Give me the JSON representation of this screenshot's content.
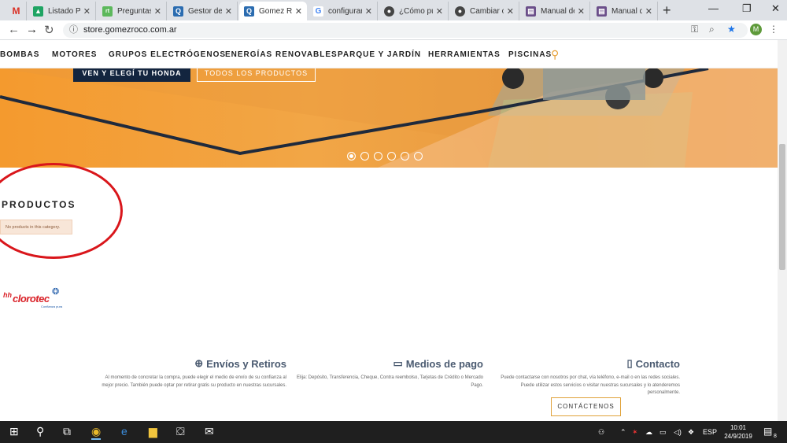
{
  "tabs": [
    {
      "label": "",
      "icon": "gmail-icon",
      "color": "#d93025"
    },
    {
      "label": "Listado Pr",
      "icon": "drive-icon",
      "color": "#1fa463"
    },
    {
      "label": "Preguntas",
      "icon": "rt-icon",
      "color": "#5cb85c"
    },
    {
      "label": "Gestor de",
      "icon": "prestashop-icon",
      "color": "#2b6cb0"
    },
    {
      "label": "Gomez Ro",
      "icon": "prestashop-icon",
      "color": "#2b6cb0"
    },
    {
      "label": "configurar",
      "icon": "google-icon",
      "color": "#4285f4"
    },
    {
      "label": "¿Cómo pu",
      "icon": "forum-icon",
      "color": "#444444"
    },
    {
      "label": "Cambiar o",
      "icon": "forum-icon",
      "color": "#444444"
    },
    {
      "label": "Manual de",
      "icon": "doc-icon",
      "color": "#6b4f8a"
    },
    {
      "label": "Manual de",
      "icon": "doc-icon",
      "color": "#6b4f8a"
    }
  ],
  "address": {
    "url": "store.gomezroco.com.ar"
  },
  "profile": {
    "initial": "M"
  },
  "site_nav": [
    "BOMBAS",
    "MOTORES",
    "GRUPOS ELECTRÓGENOS",
    "ENERGÍAS RENOVABLES",
    "PARQUE Y JARDÍN",
    "HERRAMIENTAS",
    "PISCINAS"
  ],
  "banner": {
    "btn_primary": "VEN Y ELEGÍ TU HONDA",
    "btn_secondary": "TODOS LOS PRODUCTOS",
    "slide_count": 6,
    "active_slide": 1
  },
  "products": {
    "title": "PRODUCTOS",
    "notice": "No products in this category."
  },
  "brand_logo": {
    "hh": "hh",
    "name": "clorotec",
    "tagline": "Confianza pura"
  },
  "footer": {
    "shipping": {
      "title": "Envíos y Retiros",
      "text": "Al momento de concretar la compra, puede elegir el medio de envío de su confianza al mejor precio. También puede optar por retirar gratis su producto en nuestras sucursales."
    },
    "payment": {
      "title": "Medios de pago",
      "text": "Elija: Depósito, Transferencia, Cheque, Contra reembolso, Tarjetas de Crédito o Mercado Pago."
    },
    "contact": {
      "title": "Contacto",
      "text": "Puede contactarse con nosotros por chat, vía teléfono, e-mail o en las redes sociales. Puede utilizar estos servicios o visitar nuestras sucursales y lo atenderemos personalmente.",
      "button": "CONTÁCTENOS"
    }
  },
  "taskbar": {
    "lang": "ESP",
    "time": "10:01",
    "date": "24/9/2019",
    "notifications": "8"
  },
  "colors": {
    "accent": "#e8a23a",
    "banner": "#f2a646",
    "navy": "#13253f",
    "annotation": "#d9161b"
  }
}
